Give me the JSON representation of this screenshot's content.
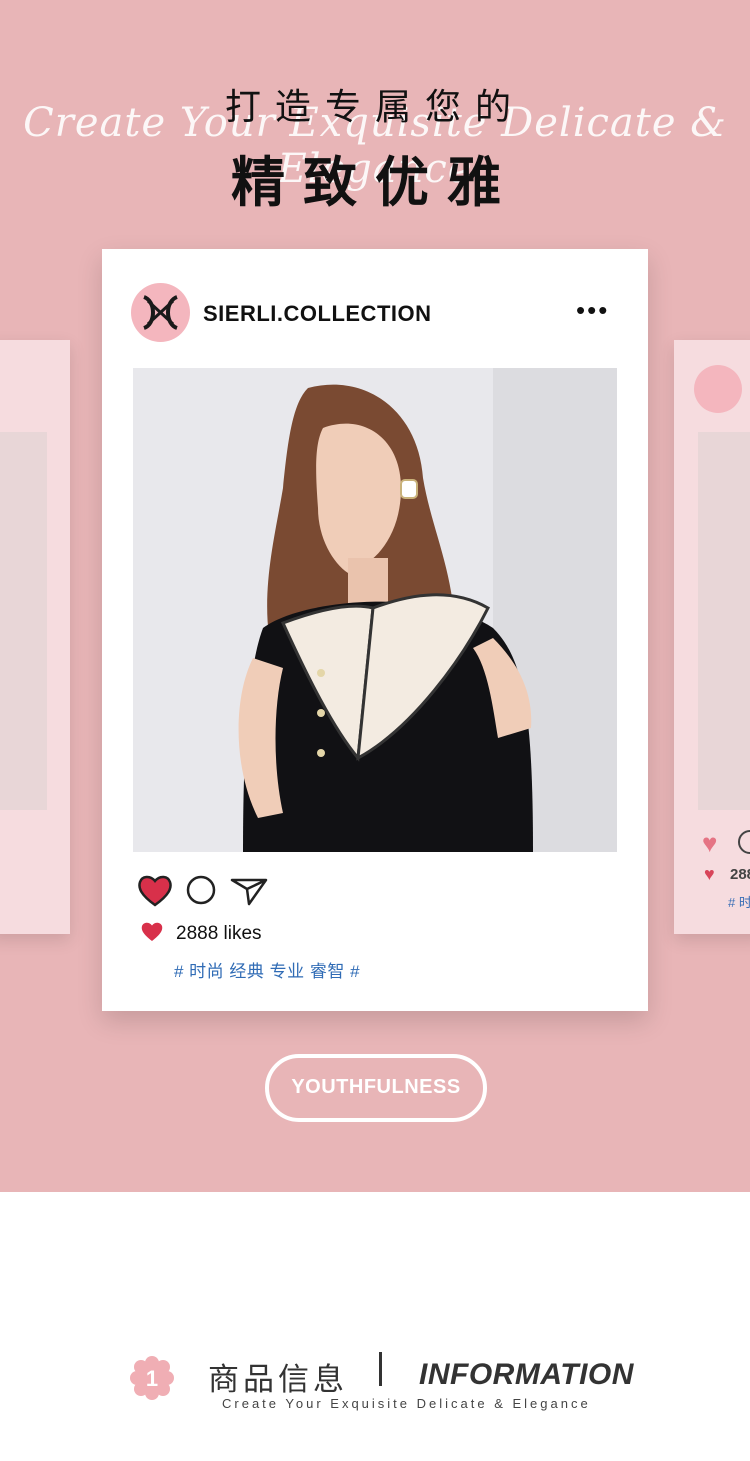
{
  "hero": {
    "script": "Create Your Exquisite Delicate & Elegance",
    "subtitle": "打造专属您的",
    "title": "精致优雅"
  },
  "post": {
    "brand": "SIERLI.COLLECTION",
    "more": "•••",
    "likes": "2888 likes",
    "tags": "# 时尚 经典 专业 睿智 #"
  },
  "side_card": {
    "likes_partial": "288",
    "tags_partial": "# 时"
  },
  "pill": {
    "label": "YOUTHFULNESS"
  },
  "info": {
    "number": "1",
    "cn": "商品信息",
    "en": "INFORMATION",
    "sub": "Create Your Exquisite Delicate & Elegance"
  },
  "colors": {
    "background_pink": "#e8b5b7",
    "logo_pink": "#f4b6be",
    "heart_red": "#d8304a",
    "tag_blue": "#2f6bb5"
  },
  "icons": [
    "heart-icon",
    "comment-icon",
    "share-icon",
    "more-icon",
    "brand-logo-icon",
    "flower-badge-icon"
  ]
}
